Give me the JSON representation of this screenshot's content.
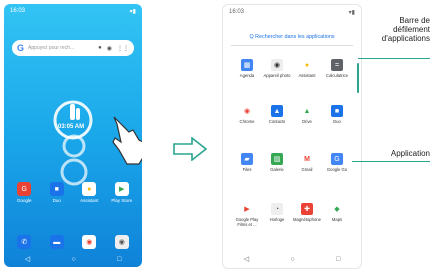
{
  "left_phone": {
    "status_time": "16:03",
    "status_icons": "▾▮",
    "search_placeholder": "Appuyez pour rech...",
    "widget_text": "03:05 AM",
    "dock_row1": [
      {
        "label": "Google",
        "icon": "google-icon",
        "color": "#ea4335"
      },
      {
        "label": "Duo",
        "icon": "video-icon",
        "color": "#1a73e8"
      },
      {
        "label": "Assistant",
        "icon": "assistant-icon",
        "color": "#fbbc04"
      },
      {
        "label": "Play Store",
        "icon": "play-icon",
        "color": "#34a853"
      }
    ],
    "dock_row2": [
      {
        "label": "",
        "icon": "phone-icon",
        "color": "#1a73e8"
      },
      {
        "label": "",
        "icon": "message-icon",
        "color": "#1a73e8"
      },
      {
        "label": "",
        "icon": "chrome-icon",
        "color": "#ea4335"
      },
      {
        "label": "",
        "icon": "camera-icon",
        "color": "#666666"
      }
    ],
    "nav": [
      "◁",
      "○",
      "□"
    ]
  },
  "right_phone": {
    "status_time": "16:03",
    "status_icons": "▾▮",
    "search_label": "Q  Rechercher dans les applications",
    "apps": [
      {
        "label": "Agenda",
        "icon": "calendar-icon",
        "color": "#4285F4"
      },
      {
        "label": "Appareil photo",
        "icon": "camera-icon",
        "color": "#555"
      },
      {
        "label": "Assistant",
        "icon": "assistant-icon",
        "color": "#fbbc04"
      },
      {
        "label": "Calculatrice",
        "icon": "calculator-icon",
        "color": "#5f6368"
      },
      {
        "label": "Chrome",
        "icon": "chrome-icon",
        "color": "#ea4335"
      },
      {
        "label": "Contacts",
        "icon": "contacts-icon",
        "color": "#1a73e8"
      },
      {
        "label": "Drive",
        "icon": "drive-icon",
        "color": "#34a853"
      },
      {
        "label": "Duo",
        "icon": "video-icon",
        "color": "#1a73e8"
      },
      {
        "label": "Files",
        "icon": "files-icon",
        "color": "#4285F4"
      },
      {
        "label": "Galerie",
        "icon": "gallery-icon",
        "color": "#34a853"
      },
      {
        "label": "Gmail",
        "icon": "gmail-icon",
        "color": "#ea4335"
      },
      {
        "label": "Google Go",
        "icon": "google-go-icon",
        "color": "#4285F4"
      },
      {
        "label": "Google Play Films et ...",
        "icon": "play-films-icon",
        "color": "#ea4335"
      },
      {
        "label": "Horloge",
        "icon": "clock-icon",
        "color": "#5f6368"
      },
      {
        "label": "Magnétophone",
        "icon": "recorder-icon",
        "color": "#ea4335"
      },
      {
        "label": "Maps",
        "icon": "maps-icon",
        "color": "#34a853"
      }
    ],
    "nav": [
      "◁",
      "○",
      "□"
    ]
  },
  "annotations": {
    "scrollbar": "Barre de défilement d'applications",
    "application": "Application"
  },
  "colors": {
    "accent": "#2aa58f"
  }
}
